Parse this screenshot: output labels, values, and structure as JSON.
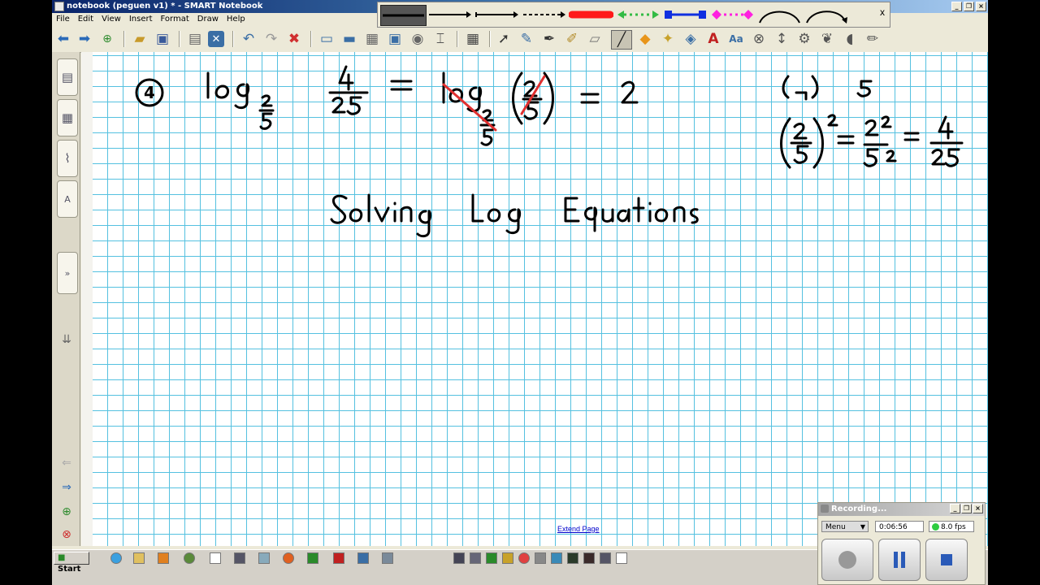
{
  "window": {
    "title": "notebook (peguen v1) * - SMART Notebook",
    "controls": [
      "_",
      "❐",
      "×"
    ]
  },
  "menu": [
    "File",
    "Edit",
    "View",
    "Insert",
    "Format",
    "Draw",
    "Help"
  ],
  "toolbar_icons": [
    "back-icon",
    "forward-icon",
    "add-page-icon",
    "open-icon",
    "save-icon",
    "paste-icon",
    "delete-icon",
    "undo-icon",
    "redo-icon",
    "clear-icon",
    "screen-shade-icon",
    "full-screen-icon",
    "capture-icon",
    "document-camera-icon",
    "record-icon",
    "insert-icon",
    "table-icon",
    "select-icon",
    "pen-icon",
    "creative-pen-icon",
    "magic-pen-icon",
    "eraser-icon",
    "line-icon",
    "shapes-icon",
    "magic-wand-icon",
    "fill-icon",
    "text-icon",
    "handwriting-icon",
    "measurement-icon",
    "move-icon",
    "properties-icon",
    "gallery-icon",
    "sound-icon",
    "pencil-icon"
  ],
  "sidebar_tabs": [
    "page-sorter-icon",
    "gallery-icon",
    "attachments-icon",
    "properties-icon"
  ],
  "line_palette": {
    "styles": [
      "selected-line",
      "arrow-line",
      "double-arrow-line",
      "dashed-line",
      "thick-red-line",
      "green-dotted-arrows",
      "blue-square-ends",
      "magenta-dotted-diamonds",
      "arc-line",
      "arc-arrow-line"
    ],
    "close_label": "x"
  },
  "canvas": {
    "extend_link": "Extend Page",
    "heading_ink": "Solving   Log   Equations",
    "problem_number": "4",
    "ink_colors": {
      "black": "#000000",
      "red": "#e03030"
    }
  },
  "taskbar": {
    "start_label": "Start"
  },
  "recorder": {
    "title": "Recording...",
    "menu_label": "Menu",
    "time": "0:06:56",
    "fps": "8.0 fps"
  }
}
